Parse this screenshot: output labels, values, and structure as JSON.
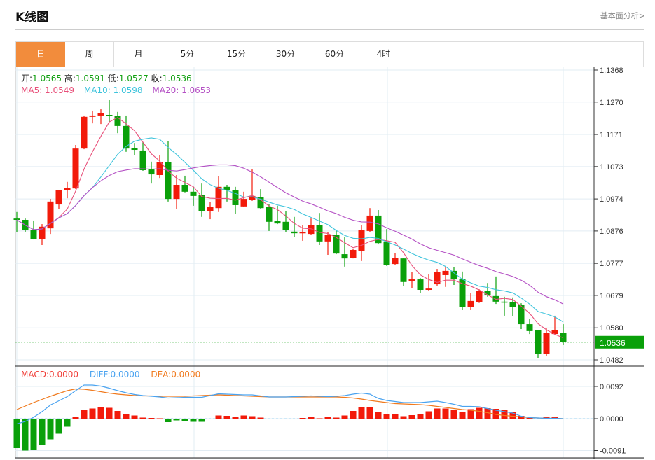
{
  "header": {
    "title": "K线图",
    "link": "基本面分析>"
  },
  "tabs": [
    {
      "label": "日",
      "active": true
    },
    {
      "label": "周"
    },
    {
      "label": "月"
    },
    {
      "label": "5分"
    },
    {
      "label": "15分"
    },
    {
      "label": "30分"
    },
    {
      "label": "60分"
    },
    {
      "label": "4时"
    }
  ],
  "legend": {
    "open_label": "开:",
    "open": "1.0565",
    "high_label": "高:",
    "high": "1.0591",
    "low_label": "低:",
    "low": "1.0527",
    "close_label": "收:",
    "close": "1.0536",
    "ma5": "MA5: 1.0549",
    "ma10": "MA10: 1.0598",
    "ma20": "MA20: 1.0653"
  },
  "macd_legend": {
    "macd": "MACD:0.0000",
    "diff": "DIFF:0.0000",
    "dea": "DEA:0.0000"
  },
  "colors": {
    "up": "#f21a0a",
    "down": "#0aa00a",
    "ma5": "#e8507a",
    "ma10": "#3fc4dc",
    "ma20": "#b450c4",
    "diff": "#4aa3f0",
    "dea": "#f07a1e",
    "accent": "#f28c3c"
  },
  "chart_data": [
    {
      "type": "candlestick",
      "title": "K线图",
      "ylim": [
        1.0482,
        1.1368
      ],
      "yticks": [
        "1.1368",
        "1.1270",
        "1.1171",
        "1.1073",
        "1.0974",
        "1.0876",
        "1.0777",
        "1.0679",
        "1.0580",
        "1.0482"
      ],
      "last_price": "1.0536",
      "ohlc": [
        [
          1.0914,
          1.0934,
          1.0872,
          1.091
        ],
        [
          1.091,
          1.0914,
          1.0872,
          1.0878
        ],
        [
          1.0878,
          1.0908,
          1.085,
          1.0852
        ],
        [
          1.0852,
          1.0897,
          1.0833,
          1.0889
        ],
        [
          1.0884,
          1.0974,
          1.0867,
          1.0966
        ],
        [
          1.0957,
          1.1002,
          1.0944,
          1.1
        ],
        [
          1.1,
          1.1026,
          1.0976,
          1.1008
        ],
        [
          1.1006,
          1.1139,
          1.1004,
          1.1128
        ],
        [
          1.1128,
          1.1229,
          1.1126,
          1.1225
        ],
        [
          1.1225,
          1.1244,
          1.1205,
          1.1229
        ],
        [
          1.1229,
          1.1248,
          1.1203,
          1.1237
        ],
        [
          1.1231,
          1.1276,
          1.121,
          1.1227
        ],
        [
          1.1227,
          1.124,
          1.1175,
          1.1197
        ],
        [
          1.1197,
          1.1229,
          1.1118,
          1.1128
        ],
        [
          1.113,
          1.1145,
          1.1107,
          1.1124
        ],
        [
          1.1122,
          1.1148,
          1.106,
          1.1062
        ],
        [
          1.1064,
          1.1088,
          1.1021,
          1.1049
        ],
        [
          1.1047,
          1.1107,
          1.1038,
          1.1086
        ],
        [
          1.1086,
          1.115,
          1.0966,
          1.0974
        ],
        [
          1.0974,
          1.1047,
          1.0944,
          1.1017
        ],
        [
          1.1017,
          1.1045,
          1.0994,
          1.0996
        ],
        [
          1.0996,
          1.1011,
          1.0953,
          1.0983
        ],
        [
          1.0985,
          1.1021,
          1.0919,
          1.0936
        ],
        [
          1.0936,
          1.0964,
          1.0912,
          1.0949
        ],
        [
          1.0946,
          1.1043,
          1.0934,
          1.1011
        ],
        [
          1.1011,
          1.1017,
          1.0966,
          1.1
        ],
        [
          1.1002,
          1.1011,
          1.0929,
          1.0955
        ],
        [
          1.0951,
          1.0996,
          1.0949,
          1.0974
        ],
        [
          1.0972,
          1.1064,
          1.0968,
          1.0983
        ],
        [
          1.0979,
          1.1004,
          1.0944,
          1.0946
        ],
        [
          1.0949,
          1.0959,
          1.0876,
          1.0904
        ],
        [
          1.0906,
          1.0953,
          1.0897,
          1.0899
        ],
        [
          1.0904,
          1.0936,
          1.0872,
          1.0878
        ],
        [
          1.0874,
          1.0919,
          1.0857,
          1.0869
        ],
        [
          1.087,
          1.0893,
          1.0846,
          1.0872
        ],
        [
          1.0867,
          1.0914,
          1.0865,
          1.0895
        ],
        [
          1.0895,
          1.0931,
          1.0833,
          1.0844
        ],
        [
          1.0844,
          1.0872,
          1.0803,
          1.0863
        ],
        [
          1.0863,
          1.0876,
          1.0805,
          1.0807
        ],
        [
          1.0805,
          1.0857,
          1.0767,
          1.0792
        ],
        [
          1.0794,
          1.0822,
          1.0792,
          1.0818
        ],
        [
          1.0814,
          1.0893,
          1.0784,
          1.088
        ],
        [
          1.0876,
          1.0946,
          1.0872,
          1.0923
        ],
        [
          1.0923,
          1.094,
          1.0835,
          1.0839
        ],
        [
          1.0844,
          1.0882,
          1.0769,
          1.0771
        ],
        [
          1.0775,
          1.0809,
          1.0771,
          1.0794
        ],
        [
          1.0792,
          1.0792,
          1.0707,
          1.072
        ],
        [
          1.0722,
          1.075,
          1.0702,
          1.0728
        ],
        [
          1.0728,
          1.0732,
          1.0687,
          1.0696
        ],
        [
          1.0696,
          1.0743,
          1.0694,
          1.07
        ],
        [
          1.0713,
          1.076,
          1.0709,
          1.075
        ],
        [
          1.0741,
          1.0769,
          1.0705,
          1.0754
        ],
        [
          1.0754,
          1.0765,
          1.0711,
          1.0728
        ],
        [
          1.0728,
          1.0752,
          1.0634,
          1.0643
        ],
        [
          1.0643,
          1.0687,
          1.0634,
          1.0662
        ],
        [
          1.0658,
          1.0698,
          1.0656,
          1.0692
        ],
        [
          1.0692,
          1.0717,
          1.0675,
          1.0679
        ],
        [
          1.0677,
          1.0737,
          1.0653,
          1.066
        ],
        [
          1.066,
          1.0675,
          1.0617,
          1.0658
        ],
        [
          1.0658,
          1.0673,
          1.0615,
          1.0643
        ],
        [
          1.0651,
          1.0655,
          1.0576,
          1.0591
        ],
        [
          1.0591,
          1.0608,
          1.0561,
          1.057
        ],
        [
          1.0572,
          1.0574,
          1.0488,
          1.0501
        ],
        [
          1.0501,
          1.0578,
          1.0493,
          1.0565
        ],
        [
          1.0561,
          1.0617,
          1.0557,
          1.0574
        ],
        [
          1.0565,
          1.0591,
          1.0527,
          1.0536
        ]
      ],
      "ma_periods": [
        5,
        10,
        20
      ]
    },
    {
      "type": "bar",
      "title": "MACD",
      "ylim": [
        -0.0091,
        0.0092
      ],
      "yticks": [
        "0.0092",
        "0.0000",
        "-0.0091"
      ],
      "macd": [
        -0.0084,
        -0.0091,
        -0.009,
        -0.0076,
        -0.0059,
        -0.0043,
        -0.0023,
        0.0006,
        0.0024,
        0.0029,
        0.0032,
        0.0031,
        0.0022,
        0.0014,
        0.0009,
        0.0003,
        0.0002,
        0.0001,
        -0.001,
        -0.0005,
        -0.0008,
        -0.0009,
        -0.0009,
        0.0,
        0.0009,
        0.0008,
        0.0005,
        0.0009,
        0.0007,
        0.0003,
        -0.0001,
        -0.0001,
        -0.0002,
        0.0,
        0.0002,
        0.0004,
        0.0001,
        0.0004,
        0.0003,
        0.0009,
        0.0022,
        0.0032,
        0.0032,
        0.002,
        0.0012,
        0.0013,
        0.0007,
        0.001,
        0.0012,
        0.0021,
        0.0029,
        0.0029,
        0.0024,
        0.002,
        0.0027,
        0.0031,
        0.003,
        0.0028,
        0.0026,
        0.0018,
        0.0008,
        0.0002,
        0.0,
        0.0005,
        0.0005,
        0.0
      ],
      "diff": [
        -0.0015,
        -0.0008,
        0.0004,
        0.002,
        0.0039,
        0.0051,
        0.0063,
        0.008,
        0.0096,
        0.0096,
        0.0093,
        0.0087,
        0.008,
        0.0074,
        0.0069,
        0.0066,
        0.0064,
        0.0062,
        0.0059,
        0.006,
        0.0061,
        0.0061,
        0.0061,
        0.0066,
        0.0071,
        0.007,
        0.0069,
        0.0068,
        0.0068,
        0.0065,
        0.0062,
        0.0062,
        0.0062,
        0.0063,
        0.0064,
        0.0065,
        0.0064,
        0.0063,
        0.0064,
        0.0066,
        0.007,
        0.0073,
        0.007,
        0.0058,
        0.0052,
        0.0049,
        0.0046,
        0.0046,
        0.0046,
        0.0048,
        0.005,
        0.0046,
        0.0041,
        0.0035,
        0.0035,
        0.0034,
        0.0029,
        0.0024,
        0.002,
        0.0016,
        0.0007,
        0.0003,
        0.0002,
        0.0001,
        0.0001,
        0.0
      ],
      "dea": [
        0.0026,
        0.0036,
        0.0046,
        0.0055,
        0.0064,
        0.0072,
        0.008,
        0.0085,
        0.0084,
        0.0081,
        0.0077,
        0.0073,
        0.007,
        0.0068,
        0.0066,
        0.0065,
        0.0065,
        0.0064,
        0.0064,
        0.0064,
        0.0064,
        0.0065,
        0.0066,
        0.0067,
        0.0068,
        0.0067,
        0.0066,
        0.0065,
        0.0064,
        0.0063,
        0.0062,
        0.0062,
        0.0062,
        0.0062,
        0.0062,
        0.0062,
        0.0062,
        0.0062,
        0.0062,
        0.0061,
        0.0059,
        0.0056,
        0.0052,
        0.0049,
        0.0046,
        0.0043,
        0.0042,
        0.0041,
        0.004,
        0.0038,
        0.0035,
        0.0032,
        0.0029,
        0.0026,
        0.0024,
        0.0021,
        0.0017,
        0.0012,
        0.0009,
        0.0007,
        0.0005,
        0.0003,
        0.0002,
        0.0001,
        0.0001,
        0.0
      ]
    }
  ]
}
